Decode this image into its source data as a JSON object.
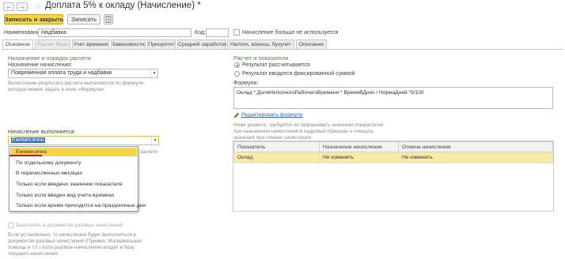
{
  "window": {
    "title": "Доплата 5% к окладу (Начисление) *"
  },
  "toolbar": {
    "save_close_label": "Записать и закрыть",
    "save_label": "Записать"
  },
  "header": {
    "name_label": "Наименование:",
    "name_value": "Надбавка",
    "code_label": "Код:",
    "code_value": "",
    "unused_label": "Начисление больше не используется"
  },
  "tabs": [
    {
      "label": "Основное"
    },
    {
      "label": "Расчет базы"
    },
    {
      "label": "Учет времени"
    },
    {
      "label": "Зависимости"
    },
    {
      "label": "Приоритет"
    },
    {
      "label": "Средний заработок"
    },
    {
      "label": "Налоги, взносы, бухучет"
    },
    {
      "label": "Описание"
    }
  ],
  "left": {
    "section_title": "Назначение и порядок расчета",
    "purpose_label": "Назначение начисления:",
    "purpose_value": "Повременная оплата труда и надбавки",
    "hint1_line1": "Вычисление результата расчета выполняется по формуле,",
    "hint1_line2": "которую можно задать в поле «Формула».",
    "executed_label": "Начисление выполняется:",
    "executed_value": "Ежемесячно",
    "hidden_tail": "засчете",
    "docs_checkbox_label": "Выполнять в документах разовых начислений",
    "hint2_line1": "Если установлено, то начисление будет выполняться в",
    "hint2_line2": "документах разовых начислений (Премия, Материальная",
    "hint2_line3": "помощь и т.п.) если разовое начисление входит в базу",
    "hint2_line4": "текущего начисления."
  },
  "dropdown": {
    "items": [
      "Ежемесячно",
      "По отдельному документу",
      "В перечисленных месяцах",
      "Только если введено значение показателя",
      "Только если введен вид учета времени",
      "Только если время приходится на праздничные дни"
    ]
  },
  "right": {
    "section_title": "Расчет и показатели",
    "radio1_label": "Результат рассчитывается",
    "radio2_label": "Результат вводится фиксированной суммой",
    "formula_label": "Формула:",
    "formula_value": "Оклад * ДоляНеполногоРабочегоВремени * ВремяВДнях / НормаДней *5/100",
    "edit_formula_link": "Редактировать формулу",
    "hint_line1": "Ниже укажите, требуется ли запрашивать значения показателей",
    "hint_line2": "при назначении начисления в кадровых приказах и очищать",
    "hint_line3": "значения при отмене начисления.",
    "table": {
      "columns": [
        "Показатель",
        "Назначение начисления",
        "Отмена начисления"
      ],
      "rows": [
        {
          "indicator": "Оклад",
          "assign": "Не изменять",
          "cancel": "Не изменять"
        }
      ]
    }
  },
  "colors": {
    "accent_yellow": "#f5d548",
    "section_green": "#4a8a3e",
    "link_blue": "#3366aa",
    "selection_row": "#fbeaa6",
    "red_underline": "#d0151a"
  }
}
